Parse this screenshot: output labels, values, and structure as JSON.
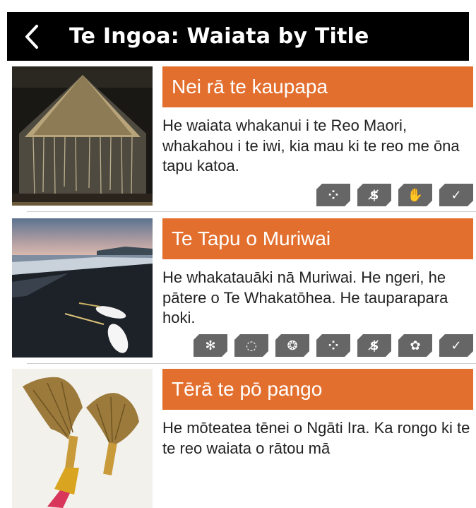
{
  "header": {
    "title": "Te Ingoa: Waiata by Title"
  },
  "items": [
    {
      "title": "Nei rā te kaupapa",
      "description": "He waiata whakanui i te Reo Maori, whakahou i te iwi, kia mau ki te reo me ōna tapu katoa.",
      "icons": [
        "pattern-icon",
        "no-money-icon",
        "hand-icon",
        "check-icon"
      ]
    },
    {
      "title": "Te Tapu o Muriwai",
      "description": "He whakatauāki nā Muriwai.  He ngeri, he pātere o Te Whakatōhea.  He tauparapara hoki.",
      "icons": [
        "sparkle-icon",
        "circle-icon",
        "swirl-icon",
        "pattern-icon",
        "no-money-icon",
        "plant-icon",
        "check-icon"
      ]
    },
    {
      "title": "Tērā te pō pango",
      "description": "He mōteatea tēnei o Ngāti Ira.  Ka rongo ki te te reo waiata o rātou mā",
      "icons": []
    }
  ]
}
